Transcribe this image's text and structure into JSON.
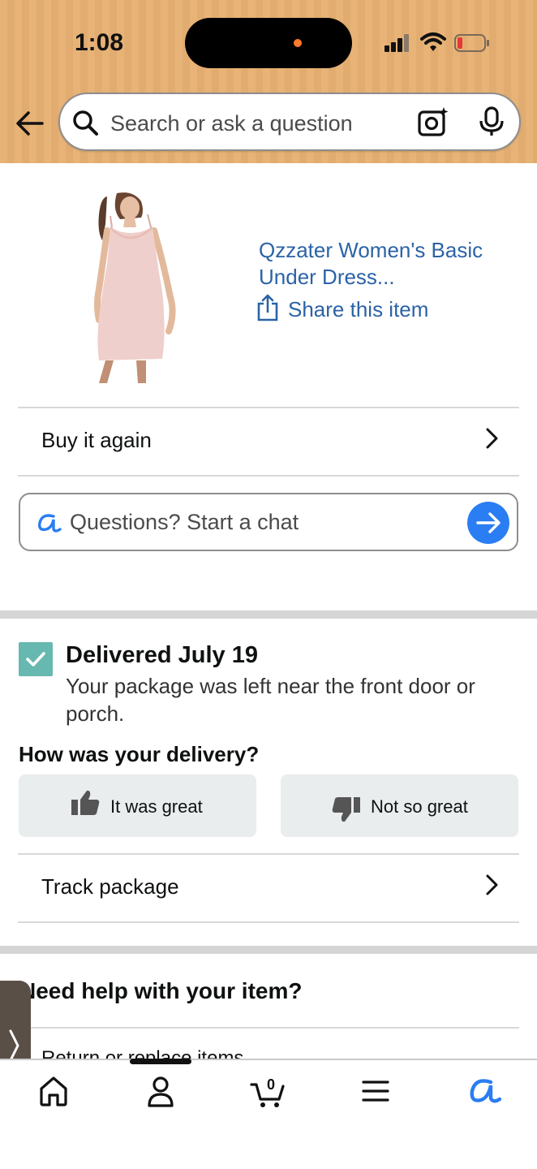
{
  "status_bar": {
    "time": "1:08",
    "icons": [
      "signal-icon",
      "wifi-icon",
      "battery-low-icon"
    ],
    "battery_color": "#e53935",
    "recording_dot_color": "#ff7b2a"
  },
  "header": {
    "background_color": "#e8b377",
    "back_icon": "arrow-left-icon",
    "search": {
      "placeholder": "Search or ask a question",
      "icons": [
        "search-icon",
        "camera-lens-icon",
        "microphone-icon"
      ]
    }
  },
  "product": {
    "title_line1": "Qzzater Women's Basic",
    "title_line2": "Under Dress...",
    "share_label": "Share this item",
    "image": "pink-slip-dress",
    "link_color": "#2b63a6"
  },
  "buy_again": {
    "label": "Buy it again"
  },
  "chat": {
    "placeholder": "Questions? Start a chat",
    "send_color": "#2a7df2"
  },
  "delivery": {
    "title": "Delivered July 19",
    "description": "Your package was left near the front door or porch.",
    "check_color": "#67b8b0",
    "feedback_question": "How was your delivery?",
    "positive_label": "It was great",
    "negative_label": "Not so great",
    "track_label": "Track package"
  },
  "help": {
    "title": "Need help with your item?",
    "first_option": "Return or replace items"
  },
  "tabbar": {
    "tabs": [
      {
        "name": "home",
        "icon": "home-icon"
      },
      {
        "name": "account",
        "icon": "person-icon"
      },
      {
        "name": "cart",
        "icon": "cart-icon",
        "badge": "0"
      },
      {
        "name": "menu",
        "icon": "hamburger-icon"
      },
      {
        "name": "rufus",
        "icon": "rufus-ai-icon"
      }
    ]
  }
}
